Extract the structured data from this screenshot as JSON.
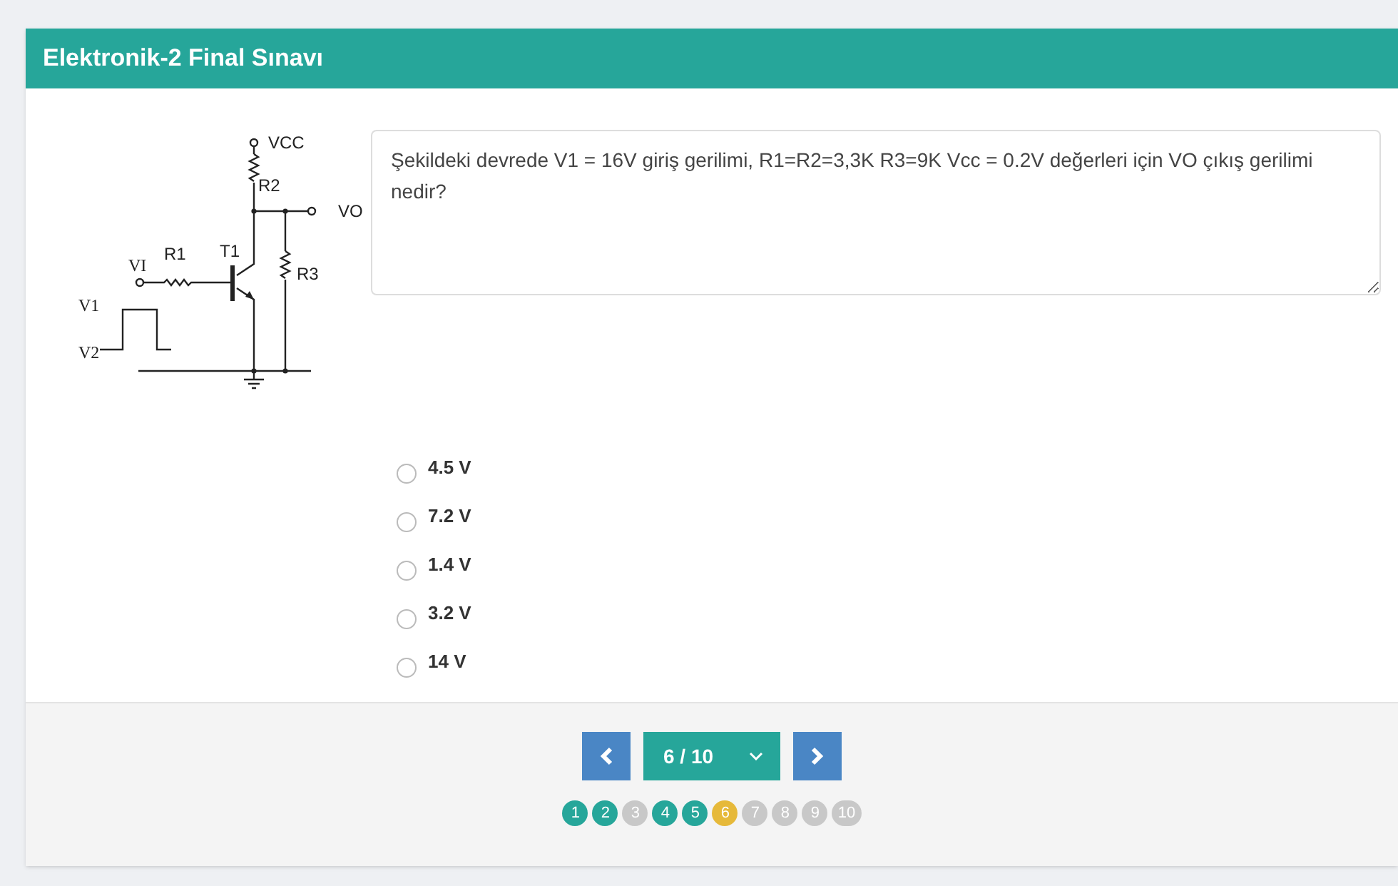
{
  "header": {
    "title": "Elektronik-2 Final Sınavı"
  },
  "circuit": {
    "labels": [
      "VCC",
      "R2",
      "VO",
      "VI",
      "R1",
      "T1",
      "R3",
      "V1",
      "V2"
    ]
  },
  "question": {
    "text": "Şekildeki devrede V1 = 16V giriş gerilimi, R1=R2=3,3K R3=9K Vcc = 0.2V değerleri için VO çıkış gerilimi nedir?"
  },
  "options": [
    {
      "label": "4.5 V",
      "selected": false
    },
    {
      "label": "7.2 V",
      "selected": false
    },
    {
      "label": "1.4 V",
      "selected": false
    },
    {
      "label": "3.2 V",
      "selected": false
    },
    {
      "label": "14 V",
      "selected": false
    }
  ],
  "pager": {
    "current": "6 / 10"
  },
  "steps": [
    {
      "label": "1",
      "kind": "answered"
    },
    {
      "label": "2",
      "kind": "answered"
    },
    {
      "label": "3",
      "kind": "unanswered"
    },
    {
      "label": "4",
      "kind": "answered"
    },
    {
      "label": "5",
      "kind": "answered"
    },
    {
      "label": "6",
      "kind": "current"
    },
    {
      "label": "7",
      "kind": "unanswered"
    },
    {
      "label": "8",
      "kind": "unanswered"
    },
    {
      "label": "9",
      "kind": "unanswered"
    },
    {
      "label": "10",
      "kind": "unanswered"
    }
  ]
}
